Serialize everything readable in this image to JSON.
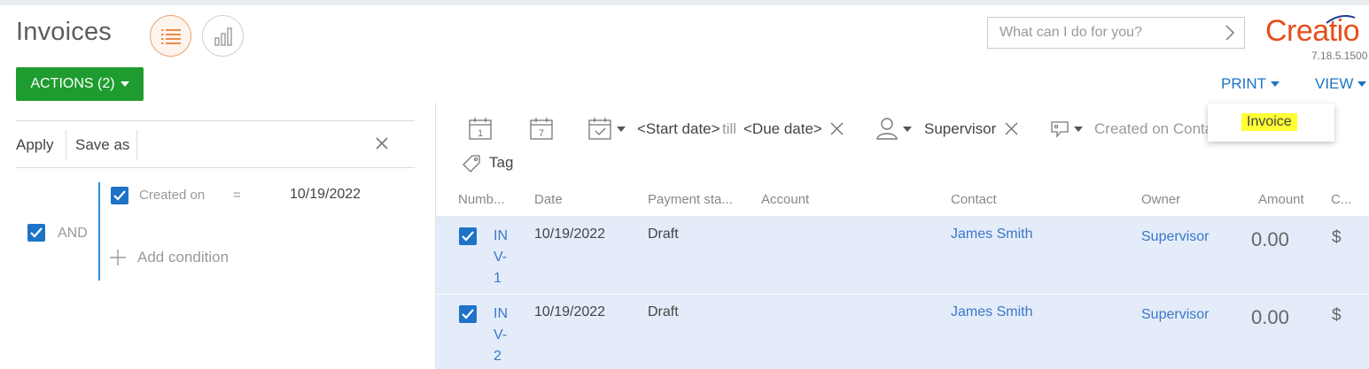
{
  "header": {
    "title": "Invoices",
    "actions_label": "ACTIONS (2)",
    "search_placeholder": "What can I do for you?",
    "logo_text": "Creatio",
    "version": "7.18.5.1500",
    "print_label": "PRINT",
    "view_label": "VIEW"
  },
  "print_menu": {
    "items": [
      "Invoice"
    ]
  },
  "filter_panel": {
    "apply_label": "Apply",
    "save_as_label": "Save as",
    "group_operator": "AND",
    "group_checked": true,
    "conditions": [
      {
        "column": "Created on",
        "operator": "=",
        "value": "10/19/2022",
        "checked": true
      }
    ],
    "add_condition_label": "Add condition"
  },
  "quick_filters": {
    "period_start": "<Start date>",
    "period_till": "till",
    "period_end": "<Due date>",
    "owner": "Supervisor",
    "folder_text": "Created on  Conta",
    "tag_label": "Tag"
  },
  "grid": {
    "columns": [
      "Numb...",
      "Date",
      "Payment sta...",
      "Account",
      "Contact",
      "Owner",
      "Amount",
      "C..."
    ],
    "rows": [
      {
        "number": "INV-1",
        "date": "10/19/2022",
        "payment_status": "Draft",
        "account": "",
        "contact": "James Smith",
        "owner": "Supervisor",
        "amount": "0.00",
        "currency": "$",
        "selected": true
      },
      {
        "number": "INV-2",
        "date": "10/19/2022",
        "payment_status": "Draft",
        "account": "",
        "contact": "James Smith",
        "owner": "Supervisor",
        "amount": "0.00",
        "currency": "$",
        "selected": true
      }
    ]
  },
  "colors": {
    "accent_green": "#1f9c2f",
    "link_blue": "#1d73c5",
    "brand_orange": "#e84e1b",
    "selected_row": "#e4ecfa",
    "highlight_yellow": "#ffff34"
  },
  "icons": [
    "list-view-icon",
    "analytics-view-icon",
    "chevron-right-icon",
    "close-icon",
    "calendar-day-icon",
    "calendar-week-icon",
    "calendar-period-icon",
    "user-icon",
    "folder-tag-icon",
    "tag-icon",
    "plus-icon",
    "checkbox-checked-icon"
  ]
}
